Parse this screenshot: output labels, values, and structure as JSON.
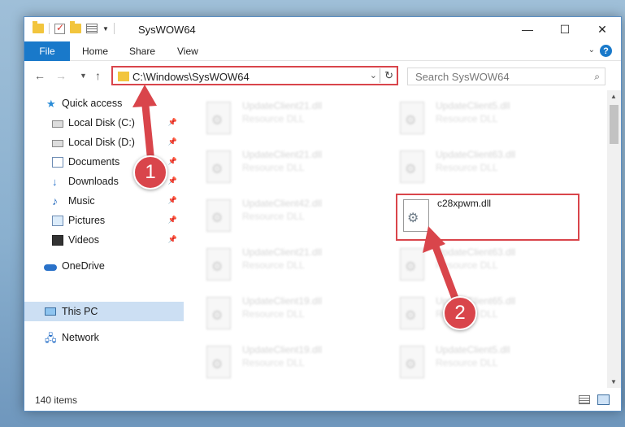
{
  "window": {
    "title": "SysWOW64",
    "controls": {
      "minimize": "—",
      "maximize": "☐",
      "close": "✕"
    }
  },
  "ribbon": {
    "file_tab": "File",
    "tabs": [
      "Home",
      "Share",
      "View"
    ]
  },
  "address_bar": {
    "path": "C:\\Windows\\SysWOW64"
  },
  "search": {
    "placeholder": "Search SysWOW64"
  },
  "sidebar": {
    "items": [
      {
        "label": "Quick access",
        "icon": "star-icon",
        "pinned": false
      },
      {
        "label": "Local Disk (C:)",
        "icon": "disk-icon",
        "pinned": true
      },
      {
        "label": "Local Disk (D:)",
        "icon": "disk-icon",
        "pinned": true
      },
      {
        "label": "Documents",
        "icon": "documents-icon",
        "pinned": true
      },
      {
        "label": "Downloads",
        "icon": "downloads-icon",
        "pinned": true
      },
      {
        "label": "Music",
        "icon": "music-icon",
        "pinned": true
      },
      {
        "label": "Pictures",
        "icon": "pictures-icon",
        "pinned": true
      },
      {
        "label": "Videos",
        "icon": "videos-icon",
        "pinned": true
      },
      {
        "label": "OneDrive",
        "icon": "onedrive-icon",
        "pinned": false
      },
      {
        "label": "This PC",
        "icon": "pc-icon",
        "pinned": false,
        "selected": true
      },
      {
        "label": "Network",
        "icon": "network-icon",
        "pinned": false
      }
    ]
  },
  "files": [
    {
      "name": "UpdateClient21.dll",
      "desc": "Resource DLL"
    },
    {
      "name": "UpdateClient5.dll",
      "desc": "Resource DLL"
    },
    {
      "name": "UpdateClient21.dll",
      "desc": "Resource DLL"
    },
    {
      "name": "UpdateClient63.dll",
      "desc": "Resource DLL"
    },
    {
      "name": "UpdateClient42.dll",
      "desc": "Resource DLL"
    },
    {
      "name": "c28xpwm.dll",
      "desc": ""
    },
    {
      "name": "UpdateClient21.dll",
      "desc": "Resource DLL"
    },
    {
      "name": "UpdateClient63.dll",
      "desc": "Resource DLL"
    },
    {
      "name": "UpdateClient19.dll",
      "desc": "Resource DLL"
    },
    {
      "name": "UpdateClient65.dll",
      "desc": "Resource DLL"
    },
    {
      "name": "UpdateClient19.dll",
      "desc": "Resource DLL"
    },
    {
      "name": "UpdateClient5.dll",
      "desc": "Resource DLL"
    }
  ],
  "status": {
    "item_count": "140 items"
  },
  "annotations": {
    "step1": "1",
    "step2": "2"
  },
  "colors": {
    "accent": "#1979ca",
    "highlight": "#d9454b"
  }
}
